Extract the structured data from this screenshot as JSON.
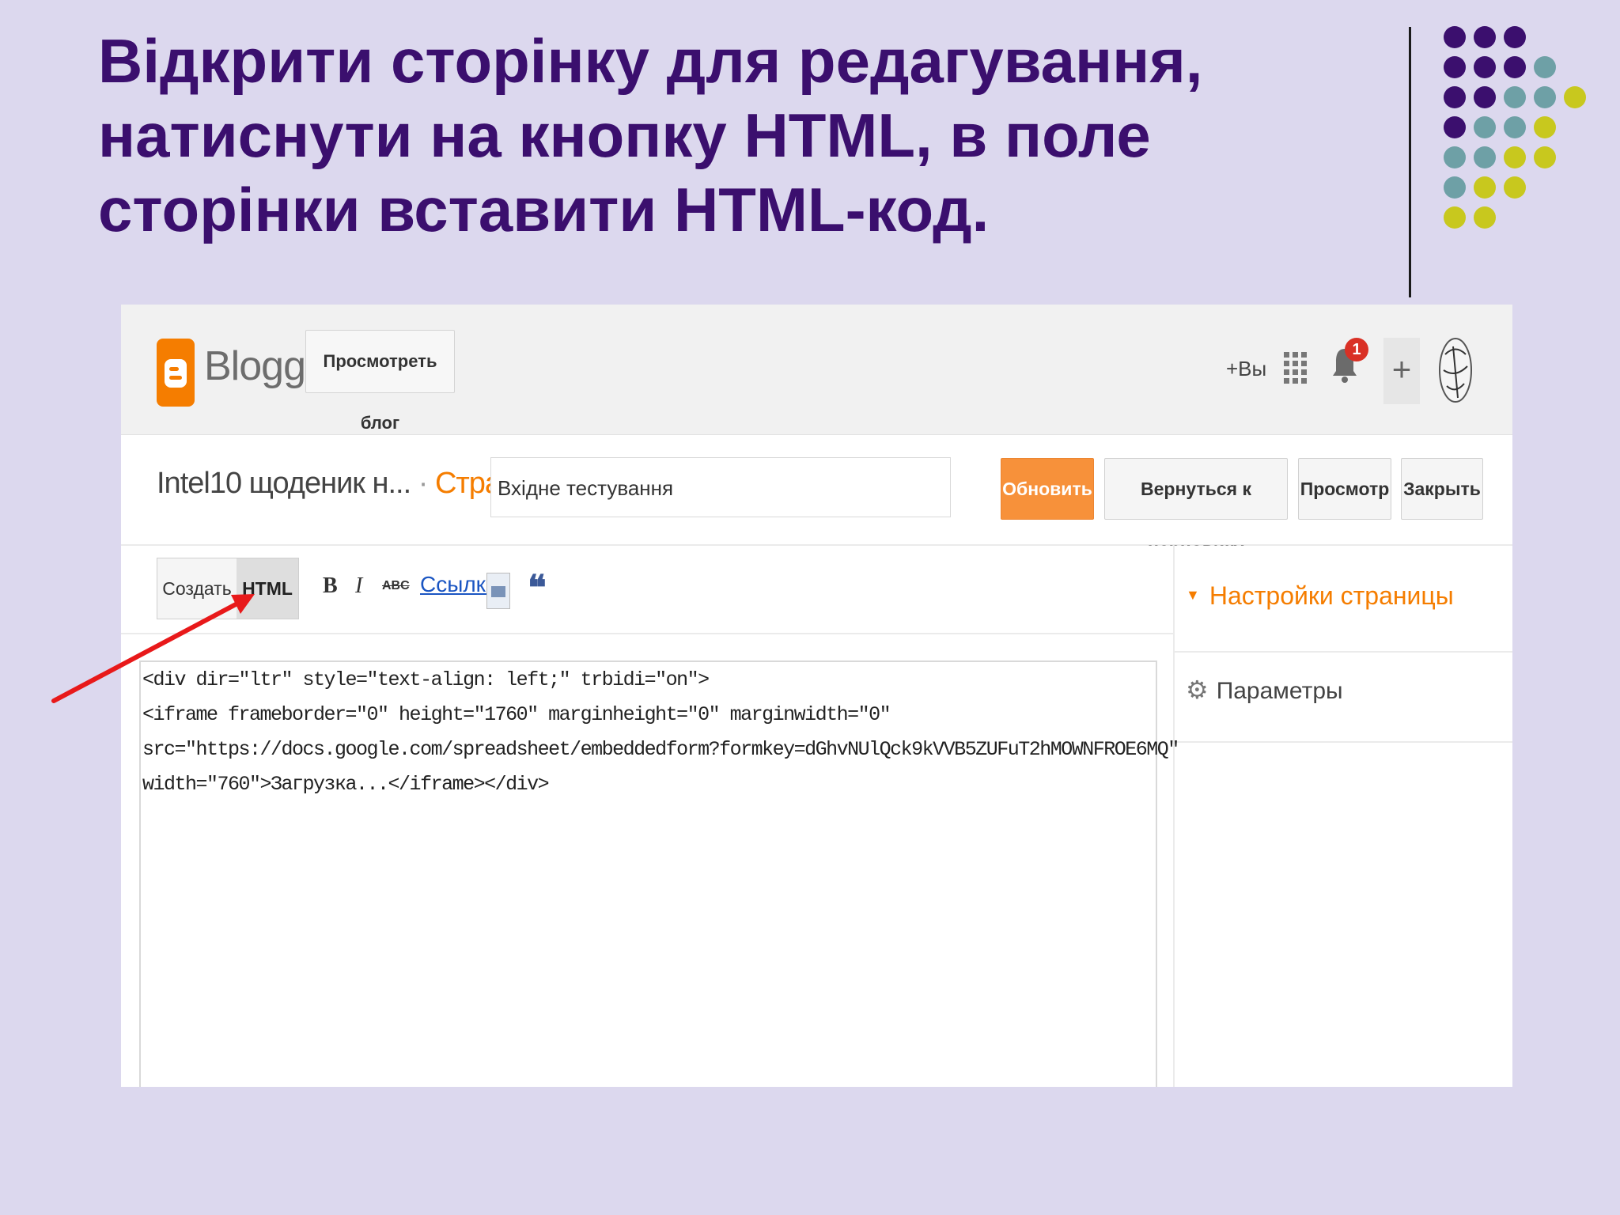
{
  "slide": {
    "title_lines": [
      "Відкрити сторінку для редагування,",
      "натиснути на кнопку HTML, в поле",
      "сторінки вставити HTML-код."
    ],
    "colors": {
      "background": "#dcd8ee",
      "title": "#3b0f6e",
      "dot_purple": "#3b0f6e",
      "dot_teal": "#6ea0a6",
      "dot_yellow": "#c8c81e",
      "arrow": "#e8191a"
    }
  },
  "blogger": {
    "topbar": {
      "logo_text": "Blogger",
      "view_blog_label": "Просмотреть блог",
      "plus_you_label": "+Вы",
      "notification_count": "1",
      "add_label": "+",
      "icons": [
        "blogger-logo-icon",
        "apps-grid-icon",
        "bell-icon",
        "plus-icon",
        "avatar"
      ]
    },
    "header": {
      "blog_name": "Intel10 щоденик н...",
      "separator": "·",
      "page_kind": "Страница",
      "title_value": "Вхідне тестування",
      "buttons": {
        "update": "Обновить",
        "revert": "Вернуться к черновику",
        "preview": "Просмотр",
        "close": "Закрыть"
      }
    },
    "toolbar": {
      "compose_label": "Создать",
      "html_label": "HTML",
      "bold": "B",
      "italic": "I",
      "strike": "ABC",
      "link_label": "Ссылка",
      "quote": "❝"
    },
    "sidebar": {
      "page_settings": "Настройки страницы",
      "params": "Параметры"
    },
    "editor": {
      "code_lines": [
        "<div dir=\"ltr\" style=\"text-align: left;\" trbidi=\"on\">",
        "<iframe frameborder=\"0\" height=\"1760\" marginheight=\"0\" marginwidth=\"0\"",
        "src=\"https://docs.google.com/spreadsheet/embeddedform?formkey=dGhvNUlQck9kVVB5ZUFuT2hMOWNFROE6MQ\"",
        "width=\"760\">Загрузка...</iframe></div>"
      ]
    }
  }
}
